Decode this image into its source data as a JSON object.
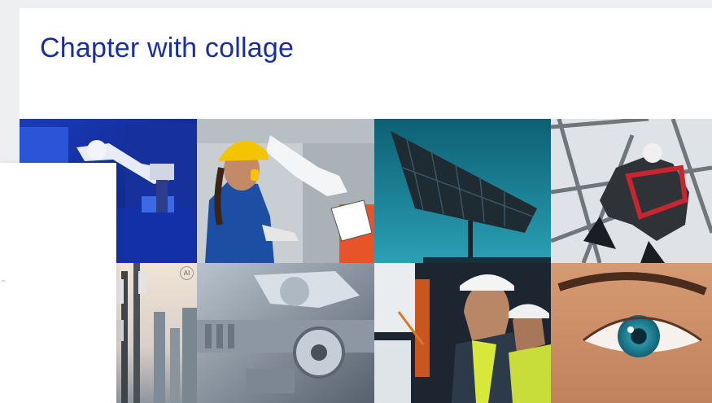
{
  "slide": {
    "title": "Chapter with collage"
  },
  "collage": {
    "tiles": [
      {
        "icon": "robot-arm-image"
      },
      {
        "icon": "worker-hardhat-image"
      },
      {
        "icon": "solar-panel-image"
      },
      {
        "icon": "tower-climber-image"
      },
      {
        "icon": "antenna-tower-image",
        "badge": "AI"
      },
      {
        "icon": "machinery-parts-image"
      },
      {
        "icon": "engineers-monitor-image"
      },
      {
        "icon": "eye-closeup-image"
      }
    ]
  },
  "colors": {
    "title": "#1b2ea1",
    "background": "#eeeff1",
    "slide": "#ffffff"
  }
}
